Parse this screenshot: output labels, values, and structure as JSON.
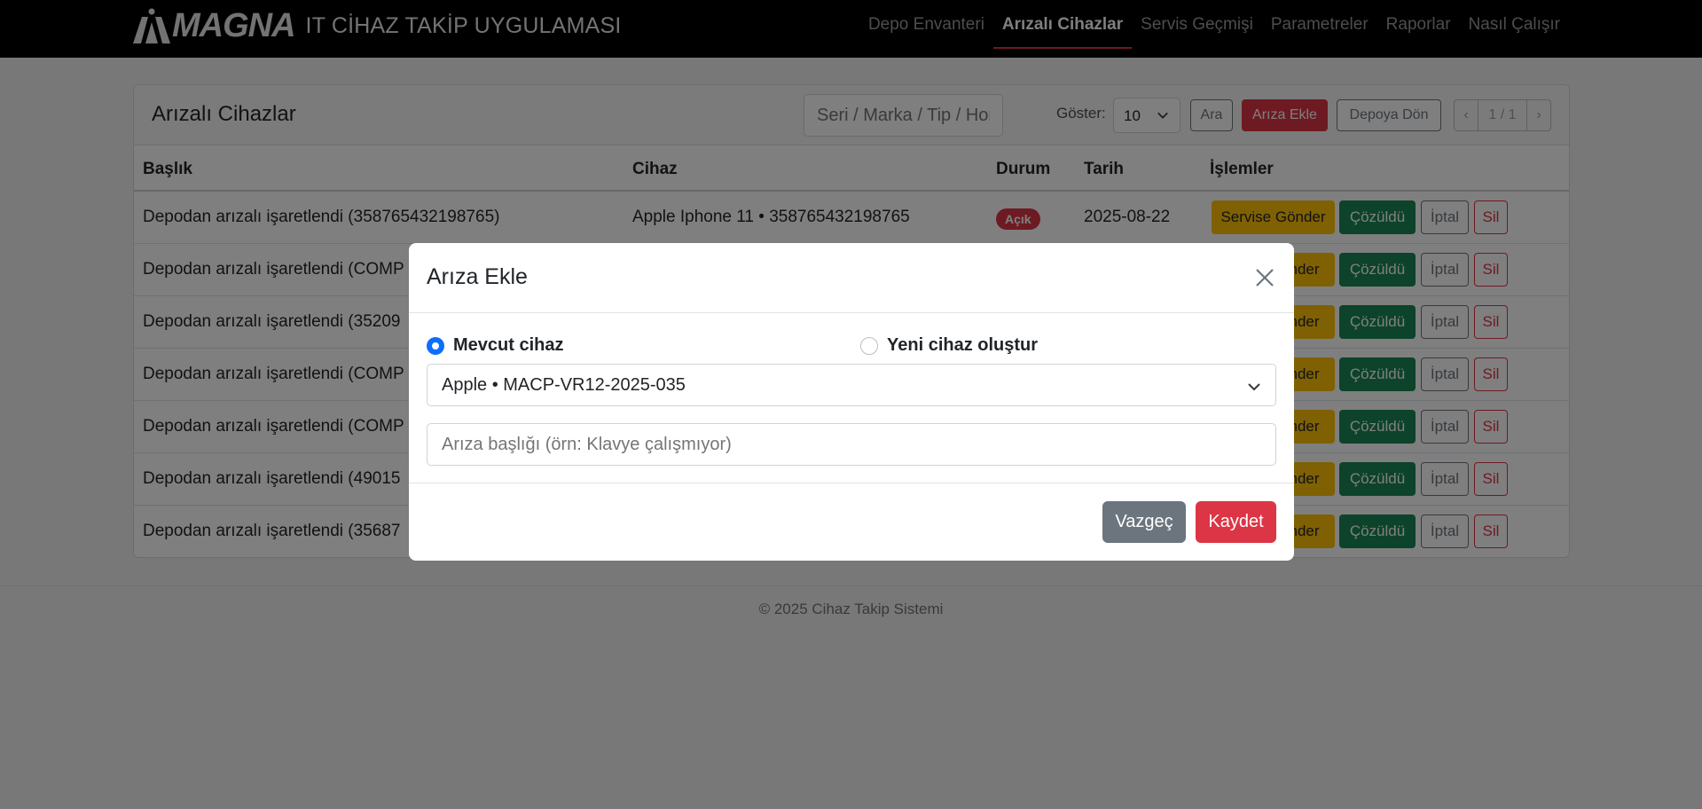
{
  "navbar": {
    "logo_text": "MAGNA",
    "app_title": "IT CİHAZ TAKİP UYGULAMASI",
    "links": [
      "Depo Envanteri",
      "Arızalı Cihazlar",
      "Servis Geçmişi",
      "Parametreler",
      "Raporlar",
      "Nasıl Çalışır"
    ],
    "active_index": 1
  },
  "card": {
    "title": "Arızalı Cihazlar",
    "search_placeholder": "Seri / Marka / Tip / Home C",
    "show_label": "Göster:",
    "page_size": "10",
    "search_button": "Ara",
    "add_button": "Arıza Ekle",
    "back_button": "Depoya Dön",
    "pager": {
      "prev": "‹",
      "info": "1 / 1",
      "next": "›"
    }
  },
  "table": {
    "headers": {
      "title": "Başlık",
      "device": "Cihaz",
      "status": "Durum",
      "date": "Tarih",
      "actions": "İşlemler"
    },
    "rows": [
      {
        "title": "Depodan arızalı işaretlendi (358765432198765)",
        "device": "Apple Iphone 11 • 358765432198765",
        "status": "Açık",
        "date": "2025-08-22"
      },
      {
        "title": "Depodan arızalı işaretlendi (COMP"
      },
      {
        "title": "Depodan arızalı işaretlendi (35209"
      },
      {
        "title": "Depodan arızalı işaretlendi (COMP"
      },
      {
        "title": "Depodan arızalı işaretlendi (COMP"
      },
      {
        "title": "Depodan arızalı işaretlendi (49015"
      },
      {
        "title": "Depodan arızalı işaretlendi (35687"
      }
    ],
    "actions": {
      "service": "Servise Gönder",
      "service_partial": "nder",
      "resolved": "Çözüldü",
      "cancel": "İptal",
      "delete": "Sil"
    }
  },
  "footer": {
    "text": "© 2025 Cihaz Takip Sistemi"
  },
  "modal": {
    "title": "Arıza Ekle",
    "radio_existing": "Mevcut cihaz",
    "radio_new": "Yeni cihaz oluştur",
    "selected_option": "existing",
    "device_select_value": "Apple • MACP-VR12-2025-035",
    "fault_title_placeholder": "Arıza başlığı (örn: Klavye çalışmıyor)",
    "cancel_button": "Vazgeç",
    "save_button": "Kaydet"
  },
  "icons": {
    "close": "close-icon",
    "chevron": "chevron-down-icon",
    "logo": "magna-logo-icon"
  },
  "colors": {
    "danger": "#dc3545",
    "warning": "#ffc107",
    "success": "#198754",
    "secondary": "#6c757d",
    "primary": "#0d6efd",
    "navbar": "#000000"
  }
}
